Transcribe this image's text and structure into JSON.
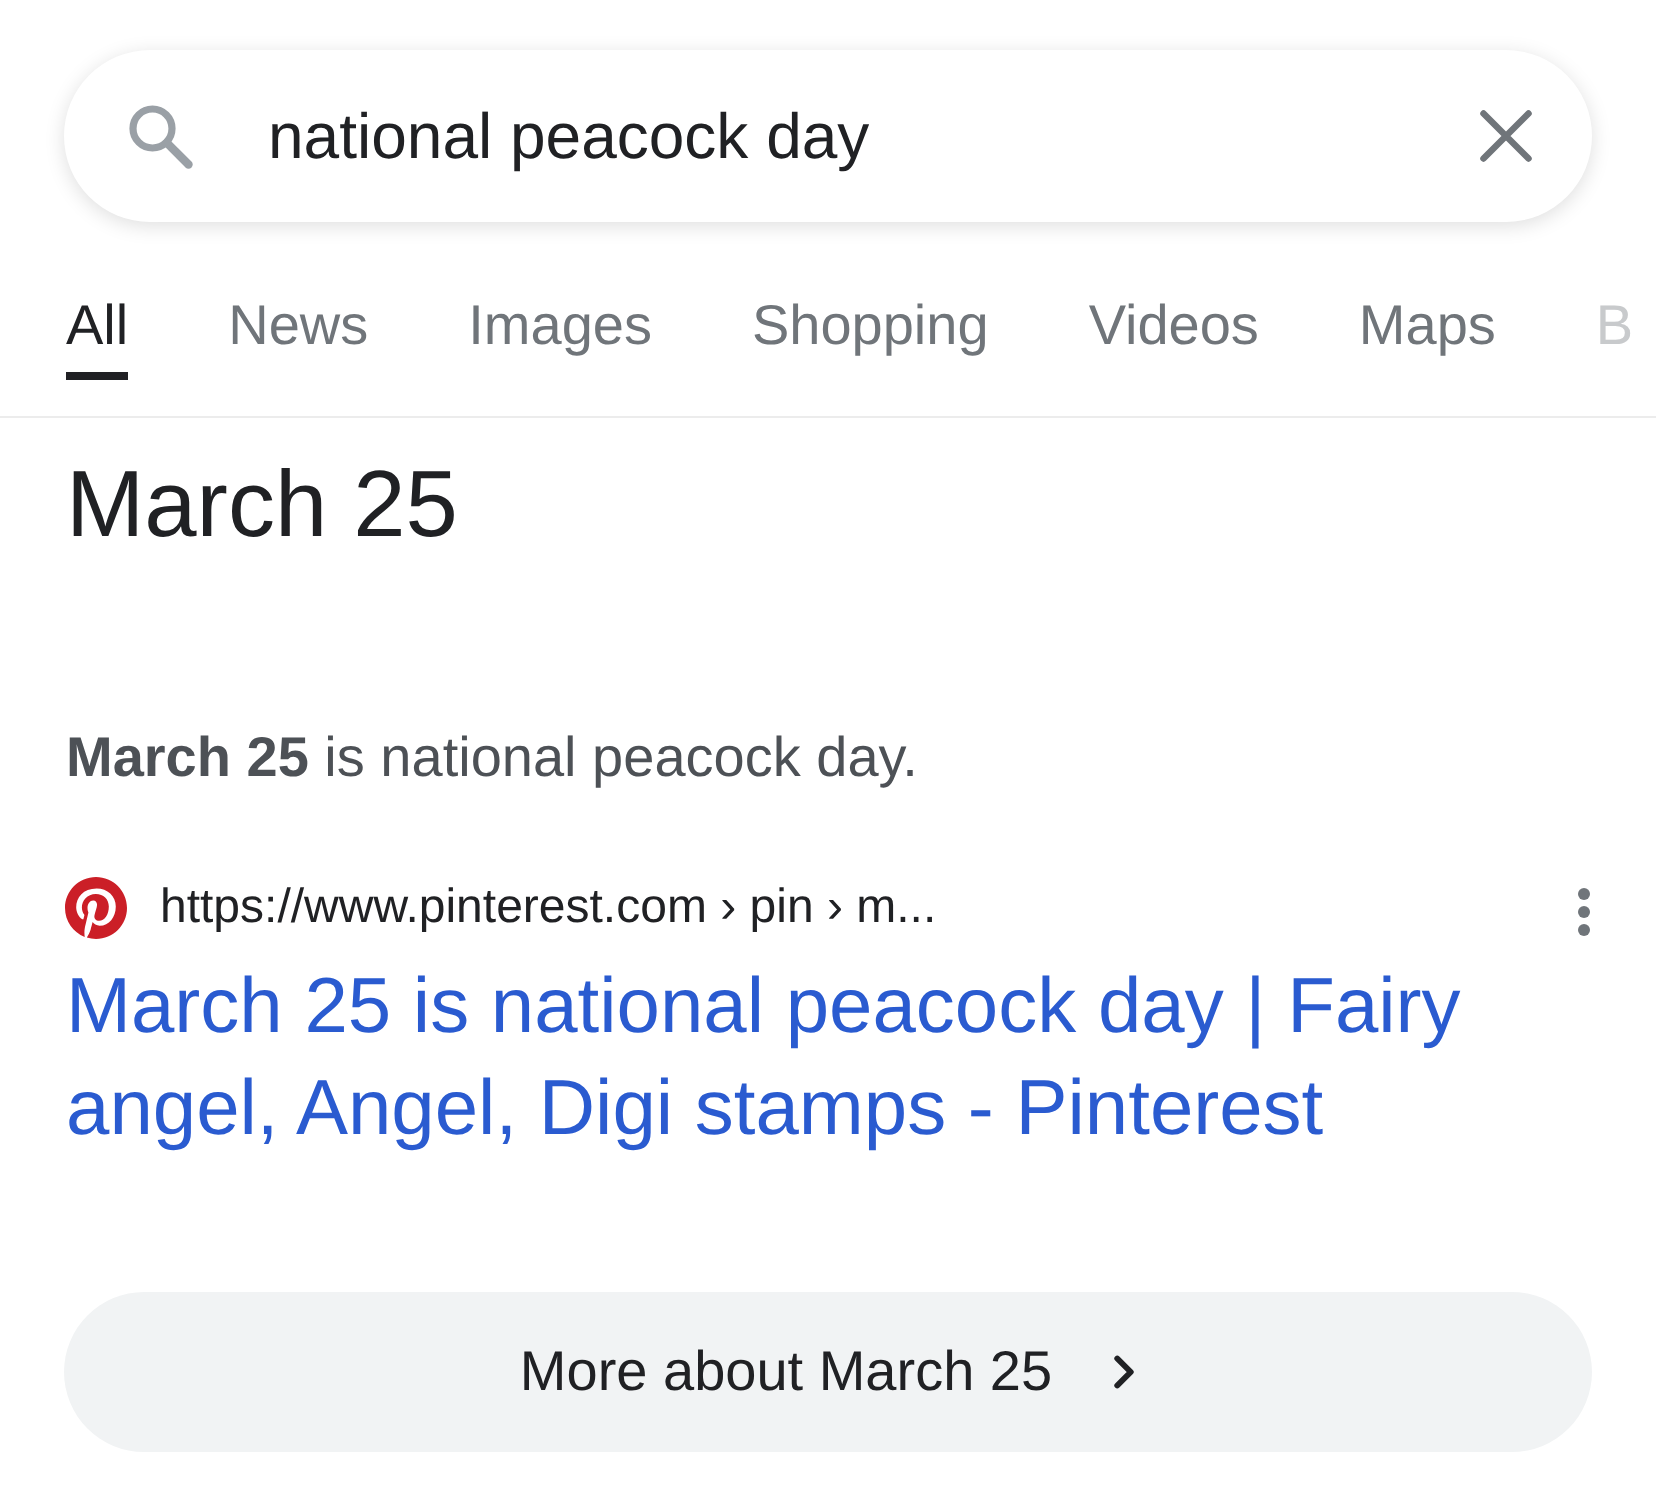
{
  "search": {
    "value": "national peacock day"
  },
  "tabs": [
    {
      "label": "All",
      "selected": true
    },
    {
      "label": "News",
      "selected": false
    },
    {
      "label": "Images",
      "selected": false
    },
    {
      "label": "Shopping",
      "selected": false
    },
    {
      "label": "Videos",
      "selected": false
    },
    {
      "label": "Maps",
      "selected": false
    },
    {
      "label": "B",
      "selected": false
    }
  ],
  "answer": {
    "heading": "March 25",
    "snippet": "**March 25** is national peacock day."
  },
  "result": {
    "url": "https://www.pinterest.com › pin › m...",
    "title": "March 25 is national peacock day | Fairy angel, Angel, Digi stamps - Pinterest"
  },
  "more_button": {
    "label": "More about March 25"
  }
}
